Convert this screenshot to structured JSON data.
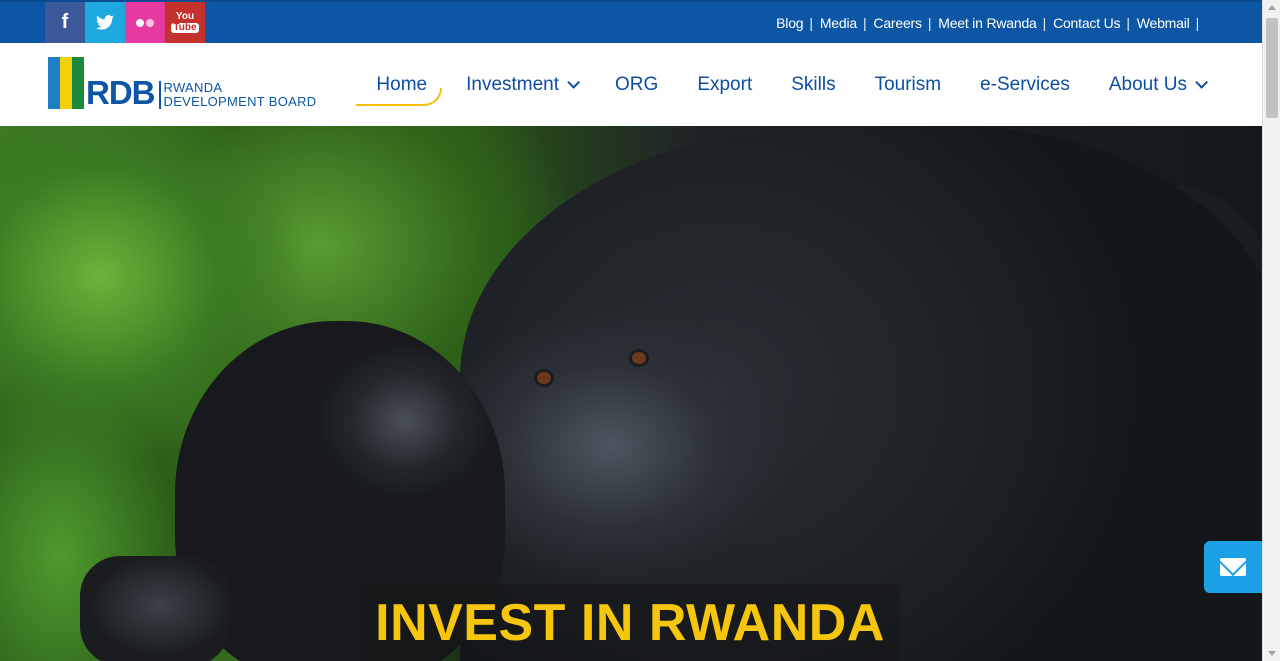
{
  "social": [
    {
      "name": "facebook-icon",
      "glyph": "f",
      "color": "#3b5999"
    },
    {
      "name": "twitter-icon",
      "glyph": "🐦",
      "color": "#1da9e0"
    },
    {
      "name": "flickr-icon",
      "glyph": "●●",
      "color": "#e63aa0"
    },
    {
      "name": "youtube-icon",
      "glyph": "You Tube",
      "color": "#c4302b"
    }
  ],
  "toplinks": [
    "Blog",
    "Media",
    "Careers",
    "Meet in Rwanda",
    "Contact Us",
    "Webmail"
  ],
  "toplink_separator": "|",
  "logo": {
    "abbr": "RDB",
    "line1": "RWANDA",
    "line2": "DEVELOPMENT BOARD",
    "flag_colors": [
      "#1f7fc4",
      "#f2d10b",
      "#1b8a3a"
    ]
  },
  "nav": [
    {
      "label": "Home",
      "dropdown": false,
      "active": true
    },
    {
      "label": "Investment",
      "dropdown": true
    },
    {
      "label": "ORG",
      "dropdown": false
    },
    {
      "label": "Export",
      "dropdown": false
    },
    {
      "label": "Skills",
      "dropdown": false
    },
    {
      "label": "Tourism",
      "dropdown": false
    },
    {
      "label": "e-Services",
      "dropdown": false
    },
    {
      "label": "About Us",
      "dropdown": true
    }
  ],
  "hero": {
    "caption": "INVEST IN RWANDA",
    "caption_color": "#f5c60d"
  },
  "colors": {
    "brand_blue": "#0d56a6",
    "accent_yellow": "#f2c10b",
    "mail_button": "#1da1e6"
  }
}
